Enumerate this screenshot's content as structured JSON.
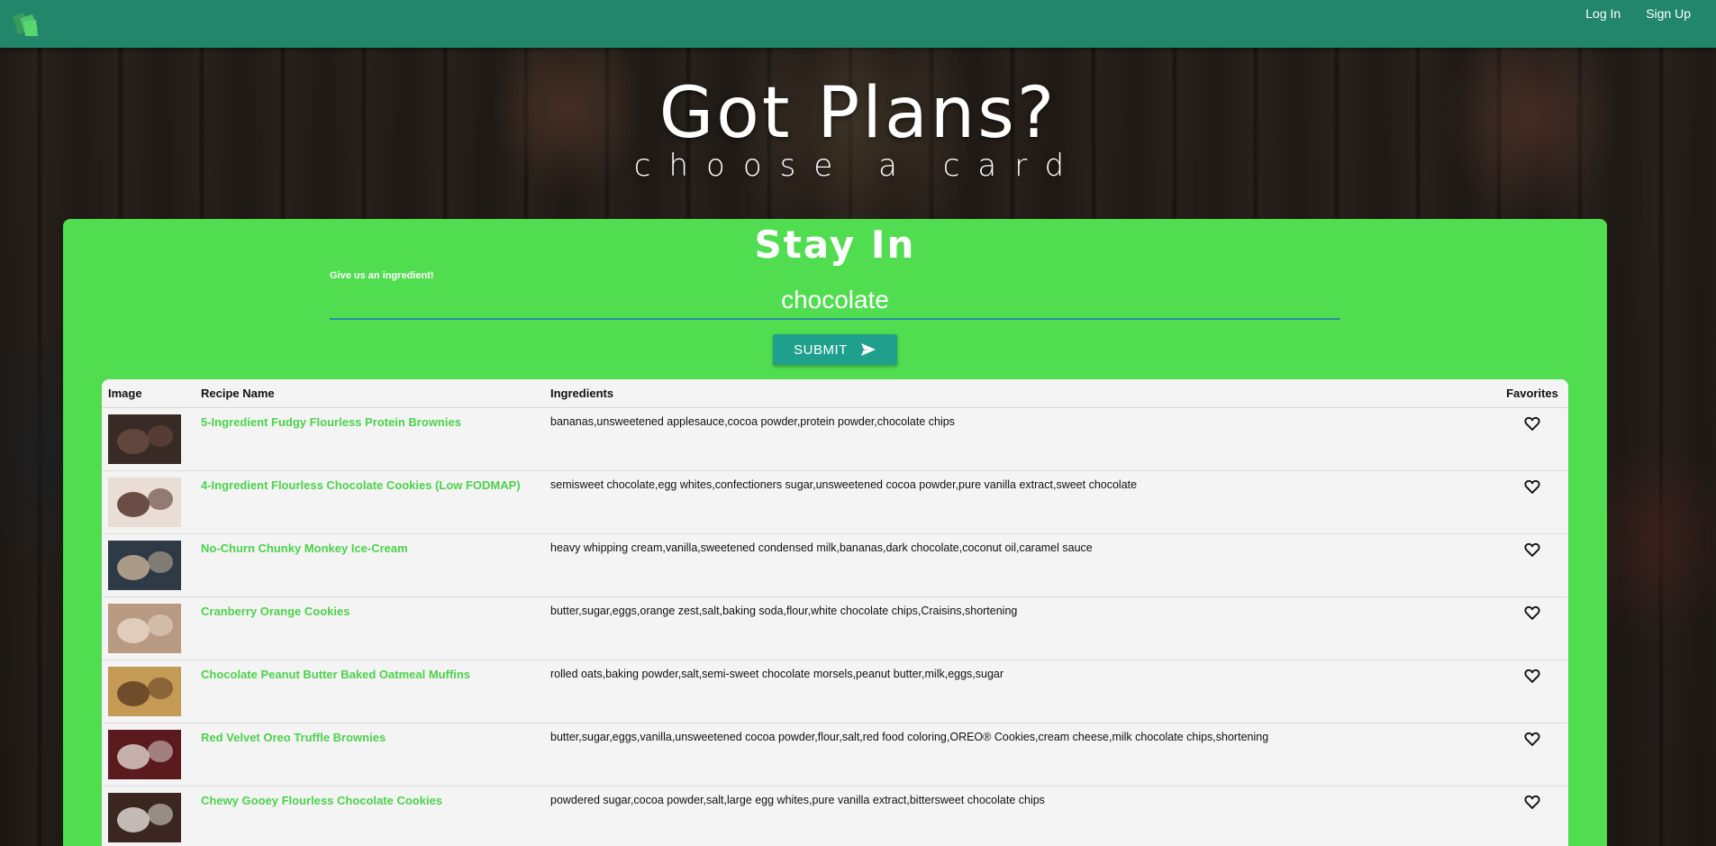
{
  "nav": {
    "login": "Log In",
    "signup": "Sign Up"
  },
  "hero": {
    "title": "Got Plans?",
    "subtitle": "choose a card"
  },
  "panel": {
    "title": "Stay In",
    "field_label": "Give us an ingredient!",
    "input_value": "chocolate",
    "submit_label": "SUBMIT"
  },
  "table": {
    "headers": [
      "Image",
      "Recipe Name",
      "Ingredients",
      "Favorites"
    ],
    "rows": [
      {
        "name": "5-Ingredient Fudgy Flourless Protein Brownies",
        "ingredients": "bananas,unsweetened applesauce,cocoa powder,protein powder,chocolate chips",
        "thumb_color": "#3a2a26",
        "thumb_accent": "#6b4d44"
      },
      {
        "name": "4-Ingredient Flourless Chocolate Cookies (Low FODMAP)",
        "ingredients": "semisweet chocolate,egg whites,confectioners sugar,unsweetened cocoa powder,pure vanilla extract,sweet chocolate",
        "thumb_color": "#e9ddd6",
        "thumb_accent": "#4a2a22"
      },
      {
        "name": "No-Churn Chunky Monkey Ice-Cream",
        "ingredients": "heavy whipping cream,vanilla,sweetened condensed milk,bananas,dark chocolate,coconut oil,caramel sauce",
        "thumb_color": "#2e3a45",
        "thumb_accent": "#c9b49a"
      },
      {
        "name": "Cranberry Orange Cookies",
        "ingredients": "butter,sugar,eggs,orange zest,salt,baking soda,flour,white chocolate chips,Craisins,shortening",
        "thumb_color": "#b89a82",
        "thumb_accent": "#e8d8c8"
      },
      {
        "name": "Chocolate Peanut Butter Baked Oatmeal Muffins",
        "ingredients": "rolled oats,baking powder,salt,semi-sweet chocolate morsels,peanut butter,milk,eggs,sugar",
        "thumb_color": "#c49a55",
        "thumb_accent": "#5a3a20"
      },
      {
        "name": "Red Velvet Oreo Truffle Brownies",
        "ingredients": "butter,sugar,eggs,vanilla,unsweetened cocoa powder,flour,salt,red food coloring,OREO® Cookies,cream cheese,milk chocolate chips,shortening",
        "thumb_color": "#5a1a1e",
        "thumb_accent": "#e0d6d0"
      },
      {
        "name": "Chewy Gooey Flourless Chocolate Cookies",
        "ingredients": "powdered sugar,cocoa powder,salt,large egg whites,pure vanilla extract,bittersweet chocolate chips",
        "thumb_color": "#3b2620",
        "thumb_accent": "#e6e0dc"
      }
    ]
  },
  "colors": {
    "navbar": "#22876a",
    "panel": "#50dd50",
    "submit": "#1fa08c",
    "recipe_link": "#4bd24b",
    "table_bg": "#f4f4f4"
  },
  "icons": {
    "logo": "cards-logo-icon",
    "submit": "send-icon",
    "favorite": "heart-outline-icon"
  }
}
